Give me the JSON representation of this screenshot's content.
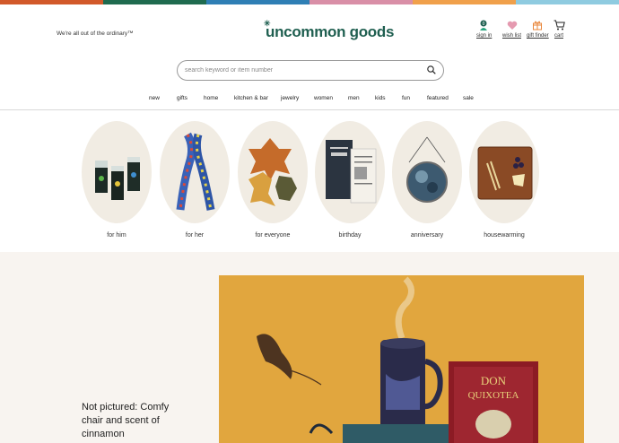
{
  "stripe_colors": [
    "#d2592a",
    "#1f6b4f",
    "#2f7fb5",
    "#d98fa7",
    "#f0a04b",
    "#8fcbe0"
  ],
  "header": {
    "tagline": "We're all out of the ordinary™",
    "logo": "uncommon goods",
    "account": [
      {
        "icon": "person-icon",
        "label": "sign in",
        "badge": "0"
      },
      {
        "icon": "heart-icon",
        "label": "wish list"
      },
      {
        "icon": "gift-icon",
        "label": "gift finder"
      },
      {
        "icon": "cart-icon",
        "label": "cart"
      }
    ]
  },
  "search": {
    "placeholder": "search keyword or item number"
  },
  "nav": [
    "new",
    "gifts",
    "home",
    "kitchen & bar",
    "jewelry",
    "women",
    "men",
    "kids",
    "fun",
    "featured",
    "sale"
  ],
  "categories": [
    "for him",
    "for her",
    "for everyone",
    "birthday",
    "anniversary",
    "housewarming"
  ],
  "feature": {
    "caption": "Not pictured: Comfy chair and scent of cinnamon",
    "book_title": "DON QUIXOTEA"
  }
}
